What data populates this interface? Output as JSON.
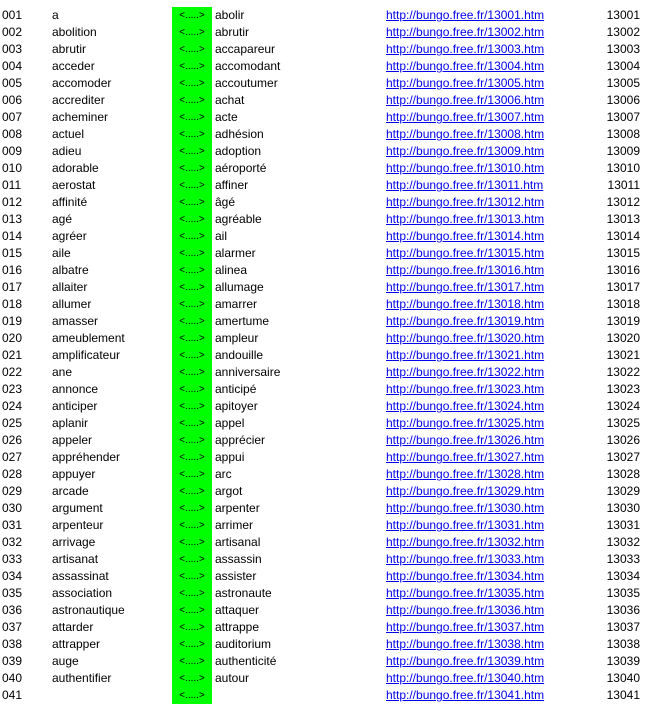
{
  "colors": {
    "separator_bg": "#00ff00",
    "link": "#0000ee",
    "text": "#000000",
    "background": "#ffffff"
  },
  "separator_text": "<.....>",
  "rows": [
    {
      "num": "001",
      "word1": "a",
      "word2": "abolir",
      "url": "http://bungo.free.fr/13001.htm",
      "code": "13001"
    },
    {
      "num": "002",
      "word1": "abolition",
      "word2": "abrutir",
      "url": "http://bungo.free.fr/13002.htm",
      "code": "13002"
    },
    {
      "num": "003",
      "word1": "abrutir",
      "word2": "accapareur",
      "url": "http://bungo.free.fr/13003.htm",
      "code": "13003"
    },
    {
      "num": "004",
      "word1": "acceder",
      "word2": "accomodant",
      "url": "http://bungo.free.fr/13004.htm",
      "code": "13004"
    },
    {
      "num": "005",
      "word1": "accomoder",
      "word2": "accoutumer",
      "url": "http://bungo.free.fr/13005.htm",
      "code": "13005"
    },
    {
      "num": "006",
      "word1": "accrediter",
      "word2": "achat",
      "url": "http://bungo.free.fr/13006.htm",
      "code": "13006"
    },
    {
      "num": "007",
      "word1": "acheminer",
      "word2": "acte",
      "url": "http://bungo.free.fr/13007.htm",
      "code": "13007"
    },
    {
      "num": "008",
      "word1": "actuel",
      "word2": "adhésion",
      "url": "http://bungo.free.fr/13008.htm",
      "code": "13008"
    },
    {
      "num": "009",
      "word1": "adieu",
      "word2": "adoption",
      "url": "http://bungo.free.fr/13009.htm",
      "code": "13009"
    },
    {
      "num": "010",
      "word1": "adorable",
      "word2": "aéroporté",
      "url": "http://bungo.free.fr/13010.htm",
      "code": "13010"
    },
    {
      "num": "011",
      "word1": "aerostat",
      "word2": "affiner",
      "url": "http://bungo.free.fr/13011.htm",
      "code": "13011"
    },
    {
      "num": "012",
      "word1": "affinité",
      "word2": "âgé",
      "url": "http://bungo.free.fr/13012.htm",
      "code": "13012"
    },
    {
      "num": "013",
      "word1": "agé",
      "word2": "agréable",
      "url": "http://bungo.free.fr/13013.htm",
      "code": "13013"
    },
    {
      "num": "014",
      "word1": "agréer",
      "word2": "ail",
      "url": "http://bungo.free.fr/13014.htm",
      "code": "13014"
    },
    {
      "num": "015",
      "word1": "aile",
      "word2": "alarmer",
      "url": "http://bungo.free.fr/13015.htm",
      "code": "13015"
    },
    {
      "num": "016",
      "word1": "albatre",
      "word2": "alinea",
      "url": "http://bungo.free.fr/13016.htm",
      "code": "13016"
    },
    {
      "num": "017",
      "word1": "allaiter",
      "word2": "allumage",
      "url": "http://bungo.free.fr/13017.htm",
      "code": "13017"
    },
    {
      "num": "018",
      "word1": "allumer",
      "word2": "amarrer",
      "url": "http://bungo.free.fr/13018.htm",
      "code": "13018"
    },
    {
      "num": "019",
      "word1": "amasser",
      "word2": "amertume",
      "url": "http://bungo.free.fr/13019.htm",
      "code": "13019"
    },
    {
      "num": "020",
      "word1": "ameublement",
      "word2": "ampleur",
      "url": "http://bungo.free.fr/13020.htm",
      "code": "13020"
    },
    {
      "num": "021",
      "word1": "amplificateur",
      "word2": "andouille",
      "url": "http://bungo.free.fr/13021.htm",
      "code": "13021"
    },
    {
      "num": "022",
      "word1": "ane",
      "word2": "anniversaire",
      "url": "http://bungo.free.fr/13022.htm",
      "code": "13022"
    },
    {
      "num": "023",
      "word1": "annonce",
      "word2": "anticipé",
      "url": "http://bungo.free.fr/13023.htm",
      "code": "13023"
    },
    {
      "num": "024",
      "word1": "anticiper",
      "word2": "apitoyer",
      "url": "http://bungo.free.fr/13024.htm",
      "code": "13024"
    },
    {
      "num": "025",
      "word1": "aplanir",
      "word2": "appel",
      "url": "http://bungo.free.fr/13025.htm",
      "code": "13025"
    },
    {
      "num": "026",
      "word1": "appeler",
      "word2": "apprécier",
      "url": "http://bungo.free.fr/13026.htm",
      "code": "13026"
    },
    {
      "num": "027",
      "word1": "appréhender",
      "word2": "appui",
      "url": "http://bungo.free.fr/13027.htm",
      "code": "13027"
    },
    {
      "num": "028",
      "word1": "appuyer",
      "word2": "arc",
      "url": "http://bungo.free.fr/13028.htm",
      "code": "13028"
    },
    {
      "num": "029",
      "word1": "arcade",
      "word2": "argot",
      "url": "http://bungo.free.fr/13029.htm",
      "code": "13029"
    },
    {
      "num": "030",
      "word1": "argument",
      "word2": "arpenter",
      "url": "http://bungo.free.fr/13030.htm",
      "code": "13030"
    },
    {
      "num": "031",
      "word1": "arpenteur",
      "word2": "arrimer",
      "url": "http://bungo.free.fr/13031.htm",
      "code": "13031"
    },
    {
      "num": "032",
      "word1": "arrivage",
      "word2": "artisanal",
      "url": "http://bungo.free.fr/13032.htm",
      "code": "13032"
    },
    {
      "num": "033",
      "word1": "artisanat",
      "word2": "assassin",
      "url": "http://bungo.free.fr/13033.htm",
      "code": "13033"
    },
    {
      "num": "034",
      "word1": "assassinat",
      "word2": "assister",
      "url": "http://bungo.free.fr/13034.htm",
      "code": "13034"
    },
    {
      "num": "035",
      "word1": "association",
      "word2": "astronaute",
      "url": "http://bungo.free.fr/13035.htm",
      "code": "13035"
    },
    {
      "num": "036",
      "word1": "astronautique",
      "word2": "attaquer",
      "url": "http://bungo.free.fr/13036.htm",
      "code": "13036"
    },
    {
      "num": "037",
      "word1": "attarder",
      "word2": "attrappe",
      "url": "http://bungo.free.fr/13037.htm",
      "code": "13037"
    },
    {
      "num": "038",
      "word1": "attrapper",
      "word2": "auditorium",
      "url": "http://bungo.free.fr/13038.htm",
      "code": "13038"
    },
    {
      "num": "039",
      "word1": "auge",
      "word2": "authenticité",
      "url": "http://bungo.free.fr/13039.htm",
      "code": "13039"
    },
    {
      "num": "040",
      "word1": "authentifier",
      "word2": "autour",
      "url": "http://bungo.free.fr/13040.htm",
      "code": "13040"
    },
    {
      "num": "041",
      "word1": "",
      "word2": "",
      "url": "http://bungo.free.fr/13041.htm",
      "code": "13041"
    }
  ]
}
